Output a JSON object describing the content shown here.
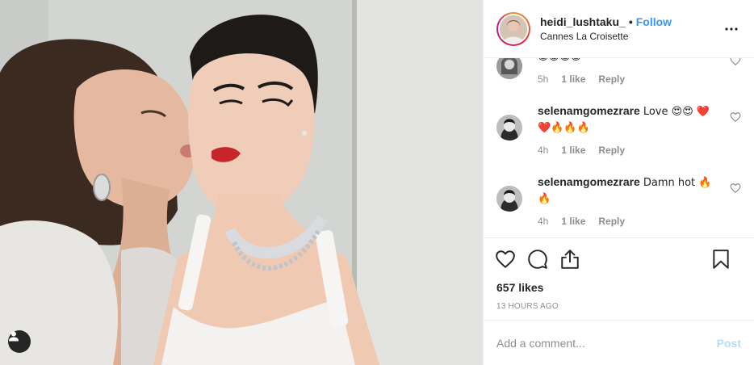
{
  "post": {
    "username": "heidi_lushtaku_",
    "separator": "•",
    "follow_label": "Follow",
    "location": "Cannes La Croisette",
    "likes_text": "657 likes",
    "time_ago": "13 HOURS AGO"
  },
  "comments": [
    {
      "username": "",
      "text": "",
      "time": "5h",
      "likes": "1 like",
      "reply": "Reply"
    },
    {
      "username": "selenamgomezrare",
      "text": "Love 😍😍 ❤️❤️🔥🔥🔥",
      "time": "4h",
      "likes": "1 like",
      "reply": "Reply"
    },
    {
      "username": "selenamgomezrare",
      "text": "Damn hot 🔥🔥",
      "time": "4h",
      "likes": "1 like",
      "reply": "Reply"
    }
  ],
  "composer": {
    "placeholder": "Add a comment...",
    "post_label": "Post"
  },
  "colors": {
    "link_blue": "#3897f0",
    "post_disabled": "#b2dffc",
    "muted_text": "#8e8e8e",
    "divider": "#efefef"
  },
  "icons": {
    "more": "more-horizontal-icon",
    "like": "heart-outline-icon",
    "comment": "speech-bubble-icon",
    "share": "share-upload-icon",
    "save": "bookmark-icon",
    "tags": "user-tag-icon"
  }
}
